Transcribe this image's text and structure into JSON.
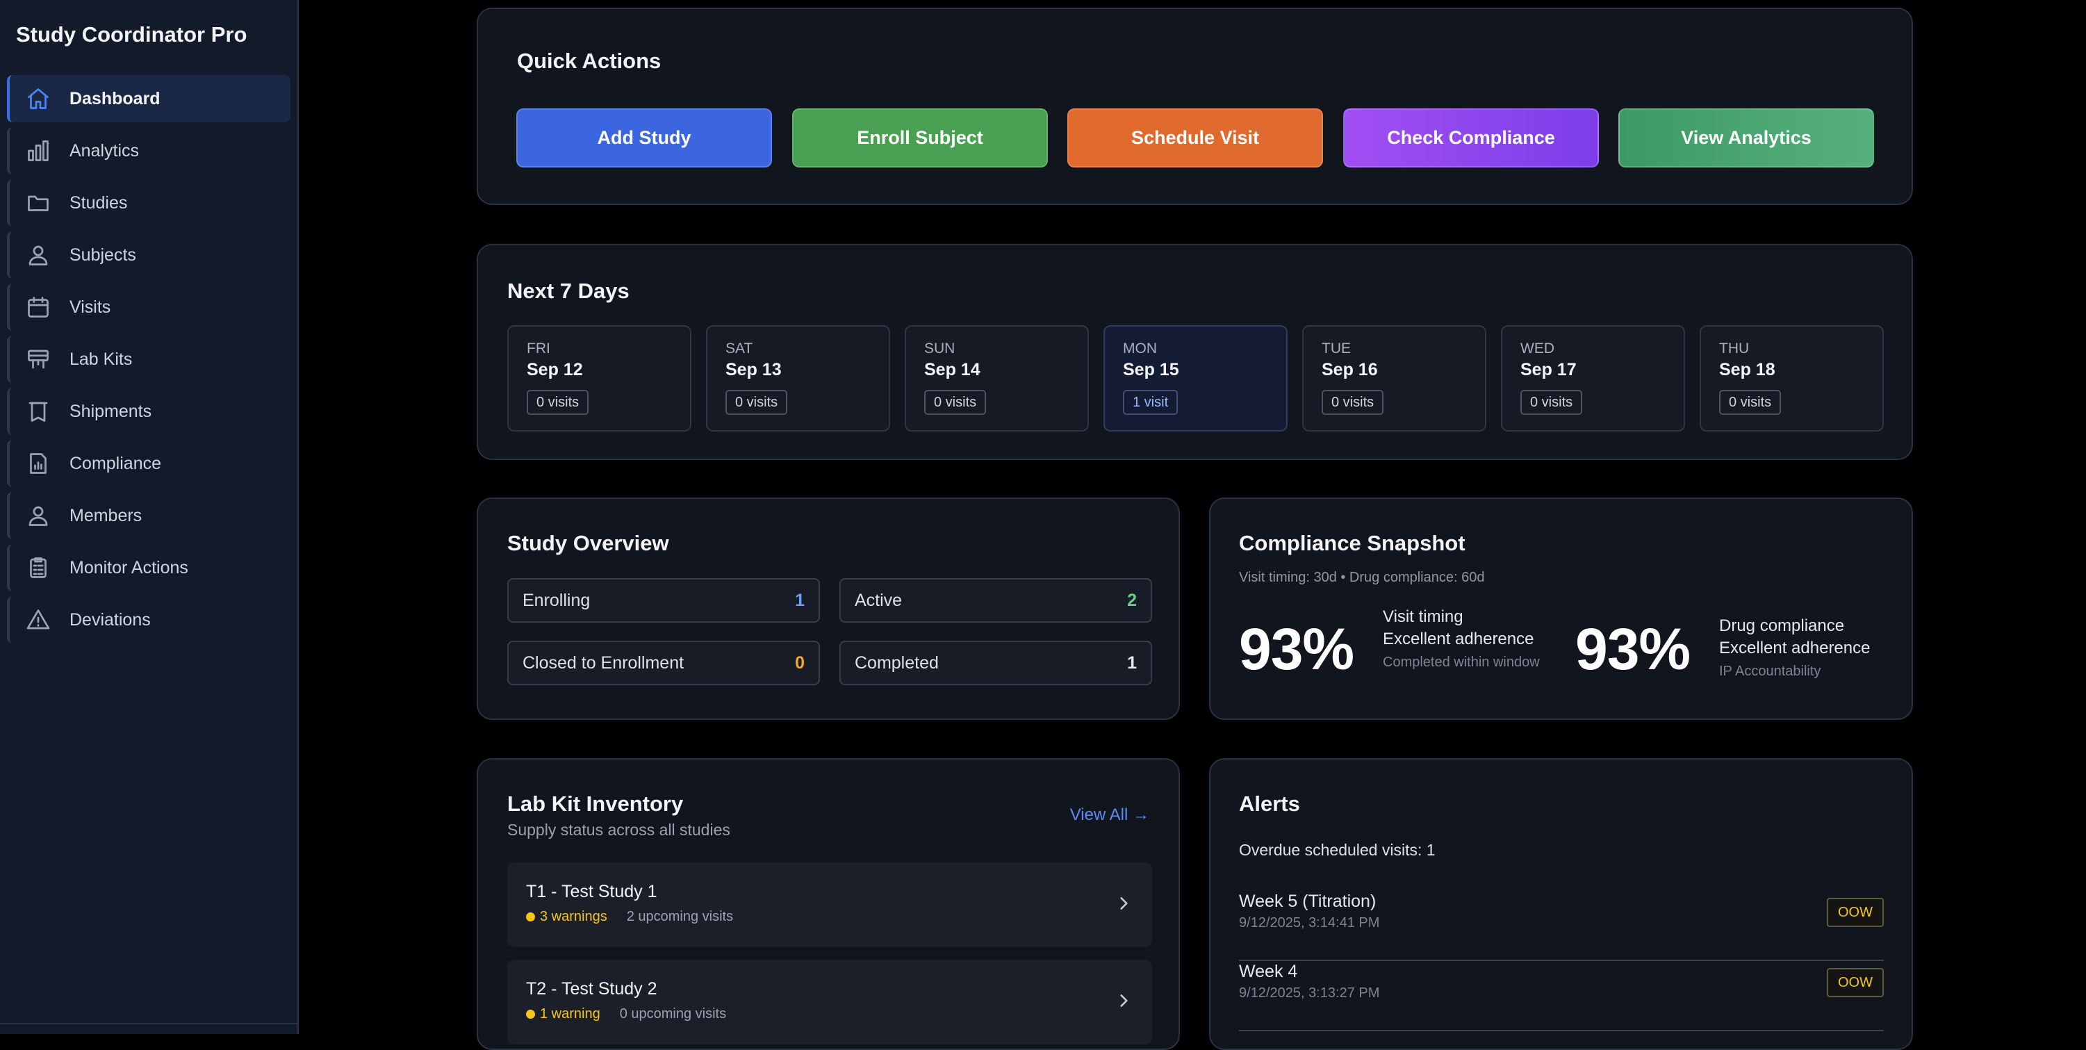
{
  "app": {
    "title": "Study Coordinator Pro"
  },
  "sidebar": {
    "items": [
      {
        "label": "Dashboard",
        "icon": "home-icon",
        "active": true
      },
      {
        "label": "Analytics",
        "icon": "bar-chart-icon",
        "active": false
      },
      {
        "label": "Studies",
        "icon": "folder-icon",
        "active": false
      },
      {
        "label": "Subjects",
        "icon": "user-icon",
        "active": false
      },
      {
        "label": "Visits",
        "icon": "calendar-icon",
        "active": false
      },
      {
        "label": "Lab Kits",
        "icon": "lab-kit-icon",
        "active": false
      },
      {
        "label": "Shipments",
        "icon": "package-icon",
        "active": false
      },
      {
        "label": "Compliance",
        "icon": "document-chart-icon",
        "active": false
      },
      {
        "label": "Members",
        "icon": "user-icon",
        "active": false
      },
      {
        "label": "Monitor Actions",
        "icon": "clipboard-icon",
        "active": false
      },
      {
        "label": "Deviations",
        "icon": "warning-icon",
        "active": false
      }
    ]
  },
  "quick_actions": {
    "title": "Quick Actions",
    "buttons": [
      {
        "label": "Add Study",
        "color": "#3b66e0"
      },
      {
        "label": "Enroll Subject",
        "color": "#4aa052"
      },
      {
        "label": "Schedule Visit",
        "color": "#e0692e"
      },
      {
        "label": "Check Compliance",
        "color": "#9247ef"
      },
      {
        "label": "View Analytics",
        "color": "#46a36e"
      }
    ]
  },
  "next_days": {
    "title": "Next 7 Days",
    "days": [
      {
        "dow": "FRI",
        "date": "Sep 12",
        "visits": "0 visits",
        "highlight": false
      },
      {
        "dow": "SAT",
        "date": "Sep 13",
        "visits": "0 visits",
        "highlight": false
      },
      {
        "dow": "SUN",
        "date": "Sep 14",
        "visits": "0 visits",
        "highlight": false
      },
      {
        "dow": "MON",
        "date": "Sep 15",
        "visits": "1 visit",
        "highlight": true
      },
      {
        "dow": "TUE",
        "date": "Sep 16",
        "visits": "0 visits",
        "highlight": false
      },
      {
        "dow": "WED",
        "date": "Sep 17",
        "visits": "0 visits",
        "highlight": false
      },
      {
        "dow": "THU",
        "date": "Sep 18",
        "visits": "0 visits",
        "highlight": false
      }
    ]
  },
  "study_overview": {
    "title": "Study Overview",
    "stats": [
      {
        "label": "Enrolling",
        "value": "1",
        "color": "#6f9cf5"
      },
      {
        "label": "Active",
        "value": "2",
        "color": "#5fd38a"
      },
      {
        "label": "Closed to Enrollment",
        "value": "0",
        "color": "#f5a524"
      },
      {
        "label": "Completed",
        "value": "1",
        "color": "#e6e9ef"
      }
    ]
  },
  "compliance": {
    "title": "Compliance Snapshot",
    "subtitle": "Visit timing: 30d • Drug compliance: 60d",
    "visit": {
      "pct": "93%",
      "name": "Visit timing",
      "status": "Excellent adherence",
      "note": "Completed within window"
    },
    "drug": {
      "pct": "93%",
      "name": "Drug compliance",
      "status": "Excellent adherence",
      "note": "IP Accountability"
    }
  },
  "lab_kits": {
    "title": "Lab Kit Inventory",
    "subtitle": "Supply status across all studies",
    "view_all": "View All →",
    "rows": [
      {
        "name": "T1 - Test Study 1",
        "warnings": "3 warnings",
        "upcoming": "2 upcoming visits"
      },
      {
        "name": "T2 - Test Study 2",
        "warnings": "1 warning",
        "upcoming": "0 upcoming visits"
      }
    ]
  },
  "alerts": {
    "title": "Alerts",
    "summary": "Overdue scheduled visits: 1",
    "items": [
      {
        "name": "Week 5 (Titration)",
        "time": "9/12/2025, 3:14:41 PM",
        "badge": "OOW"
      },
      {
        "name": "Week 4",
        "time": "9/12/2025, 3:13:27 PM",
        "badge": "OOW"
      }
    ]
  }
}
